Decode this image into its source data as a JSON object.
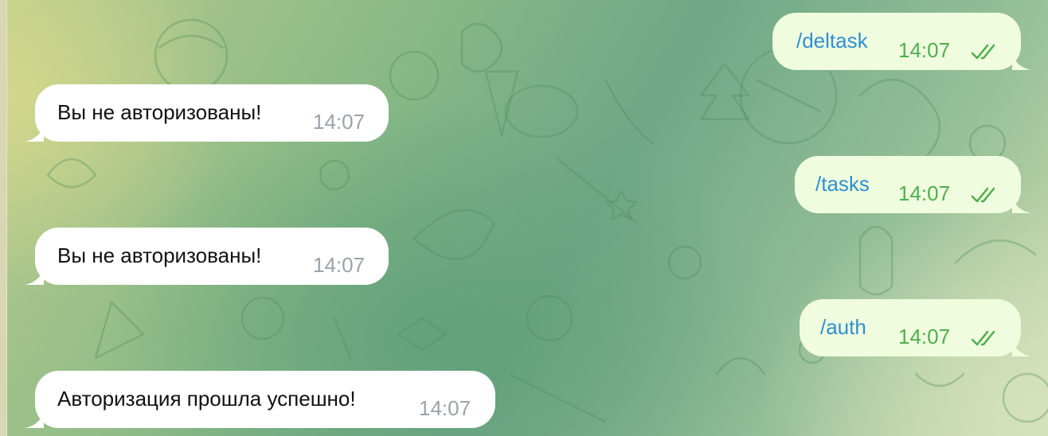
{
  "chat": {
    "incoming": [
      {
        "text": "Вы не авторизованы!",
        "time": "14:07"
      },
      {
        "text": "Вы не авторизованы!",
        "time": "14:07"
      },
      {
        "text": "Авторизация прошла успешно!",
        "time": "14:07"
      }
    ],
    "outgoing": [
      {
        "text": "/deltask",
        "time": "14:07",
        "status": "read"
      },
      {
        "text": "/tasks",
        "time": "14:07",
        "status": "read"
      },
      {
        "text": "/auth",
        "time": "14:07",
        "status": "read"
      }
    ]
  },
  "colors": {
    "incoming_bubble": "#ffffff",
    "outgoing_bubble": "#effdde",
    "command_link": "#2f8fd2",
    "outgoing_meta": "#4fae4e",
    "incoming_meta": "#9aa3aa"
  },
  "icons": {
    "read_status": "double-check-icon"
  }
}
